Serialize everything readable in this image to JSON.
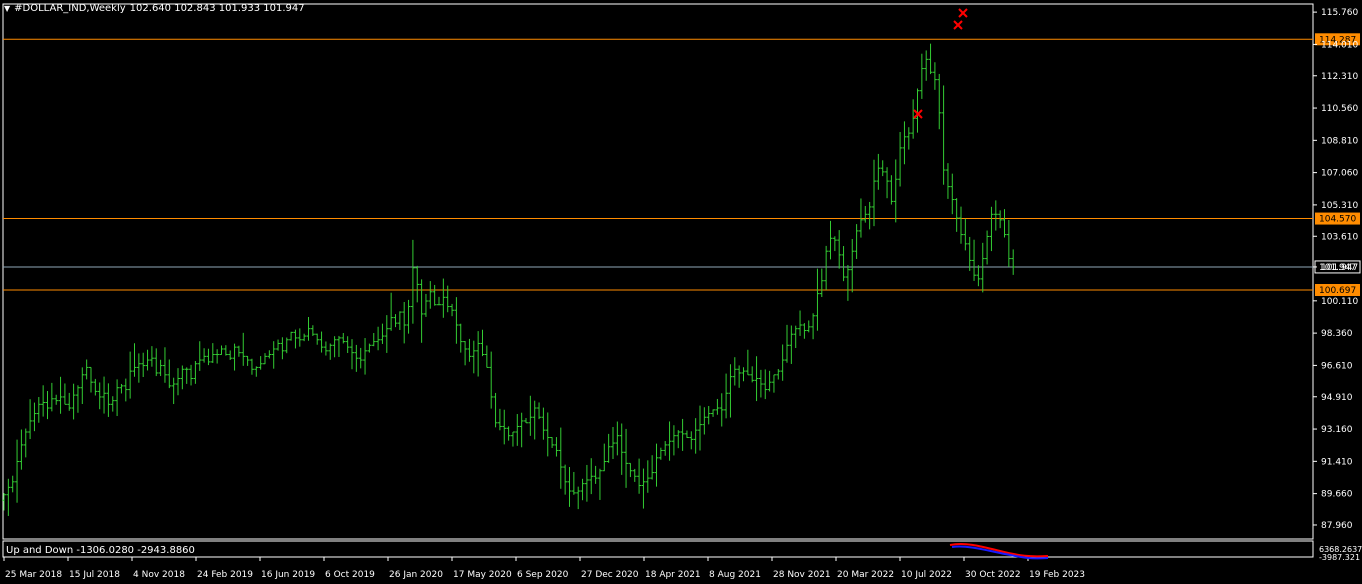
{
  "header": {
    "symbol": "#DOLLAR_IND,Weekly",
    "ohlc": "102.640 102.843 101.933 101.947"
  },
  "indicator": {
    "label": "Up and Down -1306.0280 -2943.8860",
    "axis_top": "6368.2637",
    "axis_bottom": "-3987.321"
  },
  "colors": {
    "background": "#000000",
    "bars": "#33cc33",
    "level_line": "#ff8c00",
    "current_line": "#8fa7b8",
    "marker": "#ff0000",
    "ind_red": "#ff0000",
    "ind_blue": "#1a1aff"
  },
  "chart_data": {
    "type": "ohlc",
    "timeframe": "Weekly",
    "ylim": [
      87.2,
      116.2
    ],
    "y_ticks": [
      "115.760",
      "114.010",
      "112.310",
      "110.560",
      "108.810",
      "107.060",
      "105.310",
      "103.610",
      "101.947",
      "100.110",
      "98.360",
      "96.610",
      "94.910",
      "93.160",
      "91.410",
      "89.660",
      "87.960"
    ],
    "x_ticks": [
      "25 Mar 2018",
      "15 Jul 2018",
      "4 Nov 2018",
      "24 Feb 2019",
      "16 Jun 2019",
      "6 Oct 2019",
      "26 Jan 2020",
      "17 May 2020",
      "6 Sep 2020",
      "27 Dec 2020",
      "18 Apr 2021",
      "8 Aug 2021",
      "28 Nov 2021",
      "20 Mar 2022",
      "10 Jul 2022",
      "30 Oct 2022",
      "19 Feb 2023"
    ],
    "levels": [
      {
        "value": 114.287,
        "label": "114.287",
        "style": "orange"
      },
      {
        "value": 104.57,
        "label": "104.570",
        "style": "orange"
      },
      {
        "value": 101.947,
        "label": "101.947",
        "style": "current"
      },
      {
        "value": 100.697,
        "label": "100.697",
        "style": "orange"
      }
    ],
    "closes": [
      89.6,
      90.0,
      90.3,
      91.4,
      92.3,
      93.0,
      93.6,
      94.0,
      94.5,
      94.6,
      94.3,
      94.8,
      94.7,
      94.9,
      94.5,
      94.3,
      95.0,
      95.4,
      96.1,
      96.5,
      95.7,
      95.2,
      94.9,
      95.1,
      94.5,
      94.7,
      95.4,
      95.5,
      95.3,
      96.3,
      96.5,
      96.7,
      96.6,
      96.9,
      97.0,
      96.2,
      96.6,
      96.1,
      95.5,
      95.6,
      95.9,
      96.4,
      96.4,
      95.9,
      96.7,
      96.9,
      97.1,
      96.8,
      97.2,
      97.2,
      97.5,
      97.2,
      97.0,
      97.6,
      97.3,
      97.1,
      96.9,
      96.4,
      96.5,
      96.7,
      97.1,
      97.2,
      97.5,
      97.8,
      97.4,
      98.0,
      98.4,
      98.1,
      98.0,
      98.2,
      98.6,
      98.3,
      98.0,
      97.6,
      97.4,
      97.7,
      98.0,
      98.1,
      97.9,
      97.6,
      97.3,
      97.0,
      96.9,
      97.4,
      97.7,
      97.9,
      98.0,
      98.2,
      98.6,
      99.2,
      98.9,
      99.5,
      98.8,
      99.8,
      101.9,
      101.0,
      99.4,
      100.1,
      100.6,
      99.9,
      99.9,
      100.3,
      99.8,
      99.6,
      98.8,
      97.9,
      97.5,
      97.1,
      97.4,
      97.8,
      97.2,
      96.5,
      94.9,
      93.5,
      93.3,
      93.2,
      92.8,
      93.0,
      93.3,
      93.6,
      93.5,
      93.8,
      94.3,
      93.8,
      93.1,
      92.7,
      92.3,
      92.0,
      91.1,
      90.3,
      89.8,
      89.7,
      89.8,
      90.2,
      90.4,
      90.6,
      90.5,
      90.9,
      91.4,
      92.2,
      92.4,
      92.8,
      91.9,
      91.3,
      90.9,
      90.6,
      90.1,
      90.3,
      90.5,
      90.8,
      91.6,
      92.0,
      92.3,
      92.5,
      92.8,
      93.0,
      92.9,
      92.7,
      92.6,
      93.1,
      93.4,
      93.8,
      94.0,
      94.2,
      94.3,
      94.2,
      95.1,
      96.0,
      96.4,
      96.2,
      96.3,
      96.1,
      95.8,
      95.9,
      95.6,
      95.3,
      95.7,
      96.1,
      96.3,
      96.9,
      97.7,
      98.3,
      98.6,
      98.8,
      98.5,
      98.7,
      99.3,
      100.5,
      101.2,
      102.8,
      103.5,
      103.4,
      102.6,
      101.4,
      101.8,
      102.8,
      103.9,
      104.5,
      104.8,
      105.2,
      106.6,
      107.3,
      107.1,
      106.6,
      105.5,
      106.7,
      108.4,
      109.0,
      109.2,
      110.0,
      111.5,
      112.7,
      113.2,
      112.5,
      112.1,
      110.3,
      107.2,
      106.3,
      105.6,
      104.6,
      103.7,
      103.2,
      102.3,
      101.5,
      101.3,
      102.4,
      103.6,
      104.8,
      104.8,
      104.5,
      103.7,
      102.4,
      101.947
    ]
  }
}
